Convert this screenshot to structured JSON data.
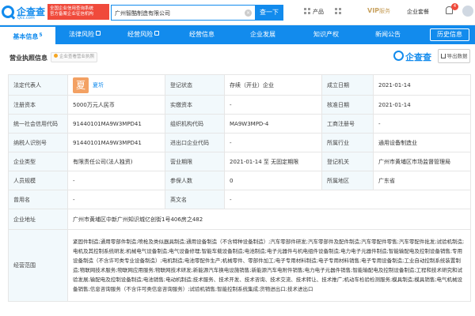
{
  "header": {
    "logo_name": "企查查",
    "logo_domain": "Qcc.com",
    "slogan_line1": "全国企业信用查询系统",
    "slogan_line2": "官方备案企业征信机构",
    "search_value": "广州智酷制造有限公司",
    "search_button": "查一下",
    "products_label": "产品",
    "vip_label": "VIP",
    "vip_sub": "服务",
    "enterprise_label": "企业套餐",
    "notification_count": "4"
  },
  "tabs": [
    {
      "label": "基本信息",
      "count": "5",
      "active": true
    },
    {
      "label": "法律风险",
      "count": ""
    },
    {
      "label": "经营风险",
      "count": ""
    },
    {
      "label": "经营信息",
      "count": ""
    },
    {
      "label": "企业发展",
      "count": ""
    },
    {
      "label": "知识产权",
      "count": ""
    },
    {
      "label": "新闻公告",
      "count": ""
    },
    {
      "label": "历史信息",
      "count": ""
    }
  ],
  "section": {
    "title": "营业执照信息",
    "badge": "企业查看营业执照",
    "watermark": "企查查",
    "export_label": "导出数据"
  },
  "info": {
    "legal_rep_label": "法定代表人",
    "legal_rep_avatar": "夏",
    "legal_rep_name": "夏圻",
    "reg_status_label": "登记状态",
    "reg_status_value": "存续（开业）企业",
    "established_label": "成立日期",
    "established_value": "2021-01-14",
    "reg_capital_label": "注册资本",
    "reg_capital_value": "5000万元人民币",
    "paid_capital_label": "实缴资本",
    "paid_capital_value": "-",
    "approval_date_label": "核准日期",
    "approval_date_value": "2021-01-14",
    "credit_code_label": "统一社会信用代码",
    "credit_code_value": "91440101MA9W3MPD41",
    "org_code_label": "组织机构代码",
    "org_code_value": "MA9W3MPD-4",
    "biz_reg_label": "工商注册号",
    "biz_reg_value": "-",
    "taxpayer_label": "纳税人识别号",
    "taxpayer_value": "91440101MA9W3MPD41",
    "import_export_label": "进出口企业代码",
    "import_export_value": "-",
    "industry_label": "所属行业",
    "industry_value": "通用设备制造业",
    "type_label": "企业类型",
    "type_value": "有限责任公司(法人独资)",
    "term_label": "营业期限",
    "term_value": "2021-01-14 至 无固定期限",
    "authority_label": "登记机关",
    "authority_value": "广州市黄埔区市场监督管理局",
    "staff_label": "人员规模",
    "staff_value": "-",
    "insured_label": "参保人数",
    "insured_value": "0",
    "region_label": "所属地区",
    "region_value": "广东省",
    "former_name_label": "曾用名",
    "former_name_value": "-",
    "english_name_label": "英文名",
    "english_name_value": "-",
    "address_label": "企业地址",
    "address_value": "广州市黄埔区中新广州知识城亿创街1号406房之482",
    "scope_label": "经营范围",
    "scope_value": "紧固件制造;通用零部件制造;喷枪及类似器具制造;通用设备制造（不含特种设备制造）;汽车零部件研发;汽车零部件及配件制造;汽车零配件零售;汽车零配件批发;试验机制造;电机及其控制系统研发;机械电气设备制造;电气设备修理;智能车载设备制造;电池制造;电子元器件与机电组件设备制造;电力电子元器件制造;智能输配电及控制设备销售;专用设备制造（不含许可类专业设备制造）;电机制造;电池零配件生产;机械零件、零部件加工;电子专用材料制造;电子专用材料销售;电子专用设备制造;工业自动控制系统装置制造;物联网技术服务;物联网应用服务;物联网技术研发;新能源汽车换电设施销售;新能源汽车电附件销售;电力电子元器件销售;智能输配电及控制设备制造;工程和技术研究和试验发展;输配电及控制设备制造;电池销售;电动机制造;技术服务、技术开发、技术咨询、技术交流、技术转让、技术推广;机动车检验检测服务;模具制造;模具销售;电气机械设备销售;信息咨询服务（不含许可类信息咨询服务）;试验机销售;智能控制系统集成;货物进出口;技术进出口"
  }
}
